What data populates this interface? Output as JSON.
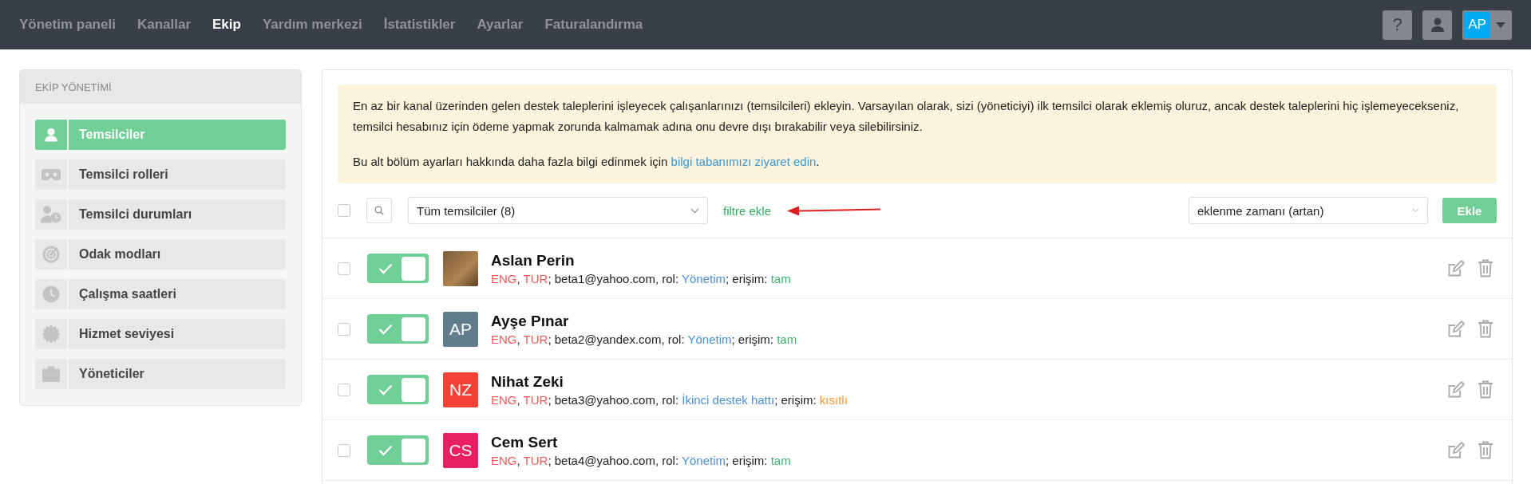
{
  "nav": {
    "items": [
      {
        "label": "Yönetim paneli",
        "selected": false
      },
      {
        "label": "Kanallar",
        "selected": false
      },
      {
        "label": "Ekip",
        "selected": true
      },
      {
        "label": "Yardım merkezi",
        "selected": false
      },
      {
        "label": "İstatistikler",
        "selected": false
      },
      {
        "label": "Ayarlar",
        "selected": false
      },
      {
        "label": "Faturalandırma",
        "selected": false
      }
    ],
    "help_label": "?",
    "user_initials": "AP"
  },
  "sidebar": {
    "title": "EKİP YÖNETİMİ",
    "items": [
      {
        "label": "Temsilciler",
        "selected": true
      },
      {
        "label": "Temsilci rolleri",
        "selected": false
      },
      {
        "label": "Temsilci durumları",
        "selected": false
      },
      {
        "label": "Odak modları",
        "selected": false
      },
      {
        "label": "Çalışma saatleri",
        "selected": false
      },
      {
        "label": "Hizmet seviyesi",
        "selected": false
      },
      {
        "label": "Yöneticiler",
        "selected": false
      }
    ]
  },
  "notice": {
    "paragraph": "En az bir kanal üzerinden gelen destek taleplerini işleyecek çalışanlarınızı (temsilcileri) ekleyin. Varsayılan olarak, sizi (yöneticiyi) ilk temsilci olarak eklemiş oluruz, ancak destek taleplerini hiç işlemeyecekseniz, temsilci hesabınız için ödeme yapmak zorunda kalmamak adına onu devre dışı bırakabilir veya silebilirsiniz.",
    "more_text": "Bu alt bölüm ayarları hakkında daha fazla bilgi edinmek için",
    "link": "bilgi tabanımızı ziyaret edin",
    "after_link": "."
  },
  "toolbar": {
    "select_all": false,
    "filter": "Tüm temsilciler (8)",
    "add_filter": "filtre ekle",
    "sort": "eklenme zamanı (artan)",
    "add_button": "Ekle"
  },
  "agents": [
    {
      "name": "Aslan Perin",
      "checked": false,
      "on": true,
      "avatar": {
        "kind": "photo"
      },
      "details": [
        {
          "kind": "language",
          "text": "ENG"
        },
        {
          "kind": "plain",
          "text": ", "
        },
        {
          "kind": "language",
          "text": "TUR"
        },
        {
          "kind": "plain",
          "text": "; beta1@yahoo.com, rol: "
        },
        {
          "kind": "role",
          "text": "Yönetim"
        },
        {
          "kind": "plain",
          "text": "; erişim: "
        },
        {
          "kind": "access",
          "text": "tam",
          "color": "#3cb371"
        }
      ]
    },
    {
      "name": "Ayşe Pınar",
      "checked": false,
      "on": true,
      "avatar": {
        "kind": "initials",
        "text": "AP",
        "color": "#607d8b"
      },
      "details": [
        {
          "kind": "language",
          "text": "ENG"
        },
        {
          "kind": "plain",
          "text": ", "
        },
        {
          "kind": "language",
          "text": "TUR"
        },
        {
          "kind": "plain",
          "text": "; beta2@yandex.com, rol: "
        },
        {
          "kind": "role",
          "text": "Yönetim"
        },
        {
          "kind": "plain",
          "text": "; erişim: "
        },
        {
          "kind": "access",
          "text": "tam",
          "color": "#3cb371"
        }
      ]
    },
    {
      "name": "Nihat Zeki",
      "checked": false,
      "on": true,
      "avatar": {
        "kind": "initials",
        "text": "NZ",
        "color": "#f44336"
      },
      "details": [
        {
          "kind": "language",
          "text": "ENG"
        },
        {
          "kind": "plain",
          "text": ", "
        },
        {
          "kind": "language",
          "text": "TUR"
        },
        {
          "kind": "plain",
          "text": "; beta3@yahoo.com, rol: "
        },
        {
          "kind": "role",
          "text": "İkinci destek hattı"
        },
        {
          "kind": "plain",
          "text": "; erişim: "
        },
        {
          "kind": "access",
          "text": "kısıtlı",
          "color": "#ff9933"
        }
      ]
    },
    {
      "name": "Cem Sert",
      "checked": false,
      "on": true,
      "avatar": {
        "kind": "initials",
        "text": "CS",
        "color": "#e91e63"
      },
      "details": [
        {
          "kind": "language",
          "text": "ENG"
        },
        {
          "kind": "plain",
          "text": ", "
        },
        {
          "kind": "language",
          "text": "TUR"
        },
        {
          "kind": "plain",
          "text": "; beta4@yahoo.com, rol: "
        },
        {
          "kind": "role",
          "text": "Yönetim"
        },
        {
          "kind": "plain",
          "text": "; erişim: "
        },
        {
          "kind": "access",
          "text": "tam",
          "color": "#3cb371"
        }
      ]
    }
  ]
}
